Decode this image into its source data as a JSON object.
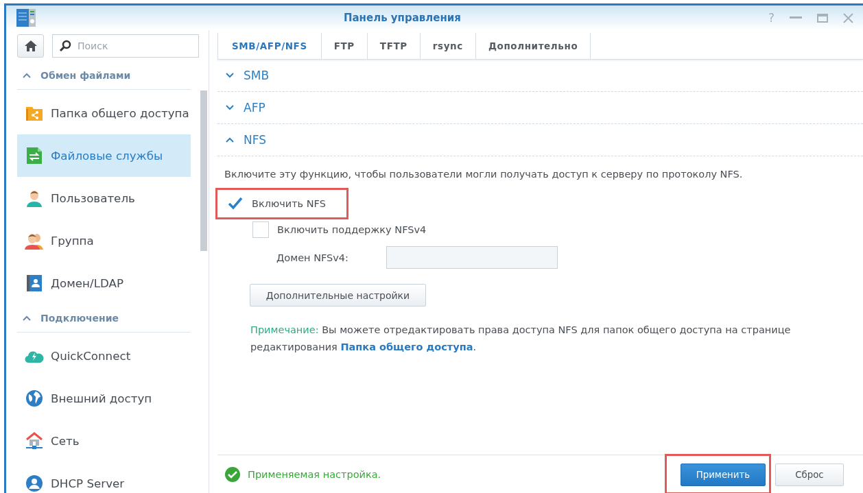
{
  "window": {
    "title": "Панель управления",
    "help": "?"
  },
  "sidebar": {
    "search": {
      "placeholder": "Поиск"
    },
    "groups": [
      {
        "title": "Обмен файлами",
        "expanded": true,
        "items": [
          {
            "label": "Папка общего доступа",
            "selected": false
          },
          {
            "label": "Файловые службы",
            "selected": true
          },
          {
            "label": "Пользователь",
            "selected": false
          },
          {
            "label": "Группа",
            "selected": false
          },
          {
            "label": "Домен/LDAP",
            "selected": false
          }
        ]
      },
      {
        "title": "Подключение",
        "expanded": true,
        "items": [
          {
            "label": "QuickConnect",
            "selected": false
          },
          {
            "label": "Внешний доступ",
            "selected": false
          },
          {
            "label": "Сеть",
            "selected": false
          },
          {
            "label": "DHCP Server",
            "selected": false
          }
        ]
      }
    ]
  },
  "tabs": [
    {
      "label": "SMB/AFP/NFS",
      "selected": true
    },
    {
      "label": "FTP",
      "selected": false
    },
    {
      "label": "TFTP",
      "selected": false
    },
    {
      "label": "rsync",
      "selected": false
    },
    {
      "label": "Дополнительно",
      "selected": false
    }
  ],
  "sections": [
    {
      "title": "SMB",
      "expanded": false
    },
    {
      "title": "AFP",
      "expanded": false
    },
    {
      "title": "NFS",
      "expanded": true
    }
  ],
  "nfs": {
    "description": "Включите эту функцию, чтобы пользователи могли получать доступ к серверу по протоколу NFS.",
    "options": [
      {
        "label": "Включить NFS",
        "checked": true,
        "highlighted": true
      },
      {
        "label": "Включить поддержку NFSv4",
        "checked": false,
        "highlighted": false
      }
    ],
    "domain": {
      "label": "Домен NFSv4:"
    },
    "advanced_button": "Дополнительные настройки",
    "note": {
      "label": "Примечание:",
      "text": "Вы можете отредактировать права доступа NFS для папок общего доступа на странице редактирования",
      "link": "Папка общего доступа",
      "suffix": "."
    }
  },
  "status": {
    "text": "Применяемая настройка."
  },
  "buttons": [
    {
      "label": "Применить",
      "primary": true,
      "highlighted": true
    },
    {
      "label": "Сброс",
      "primary": false,
      "highlighted": false
    }
  ]
}
